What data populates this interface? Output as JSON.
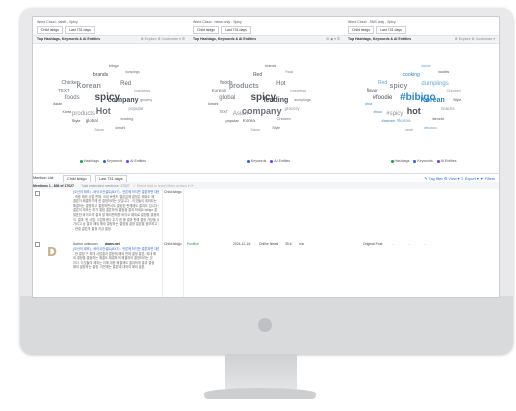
{
  "panels": [
    {
      "title": "Word Cloud - tabel - Spicy",
      "range": [
        "Child lsbigo",
        "Last 731 days"
      ],
      "bar_title": "Top Hashtags, Keywords & AI Entities",
      "tools": "⚙  Explore  ⚙ Customize ▾  ☰",
      "words": [
        "spicy",
        "Hot",
        "Korean",
        "Red",
        "company",
        "foods",
        "products",
        "Chicken",
        "brands",
        "TEXT",
        "popular",
        "global",
        "Style",
        "leading",
        "business",
        "bibigo",
        "Asian",
        "grocery",
        "Sauce",
        "kimchi",
        "Korea",
        "dumplings"
      ],
      "legend": [
        {
          "label": "Hashtags",
          "color": "#16a34a"
        },
        {
          "label": "Keywords",
          "color": "#2563eb"
        },
        {
          "label": "AI Entities",
          "color": "#7c3aed"
        }
      ]
    },
    {
      "title": "Word Cloud - news only - Spicy",
      "range": [
        "Child lsbigo",
        "Last 731 days"
      ],
      "bar_title": "Top Hashtags, Keywords & AI Entities",
      "tools": "⚙  ◉ ▾  ☰",
      "words": [
        "spicy",
        "company",
        "products",
        "Hot",
        "leading",
        "global",
        "Asian",
        "foods",
        "Red",
        "Korean",
        "grocery",
        "Korea",
        "popular",
        "Chicken",
        "business",
        "brands",
        "kimchi",
        "dumplings",
        "Sauce",
        "Style",
        "TEXT",
        "Food"
      ],
      "legend": [
        {
          "label": "Keywords",
          "color": "#2563eb"
        },
        {
          "label": "AI Entities",
          "color": "#7c3aed"
        }
      ]
    },
    {
      "title": "Word Cloud - SNS only - Spicy",
      "range": [
        "Child lsbigo",
        "Last 731 days"
      ],
      "bar_title": "Top Hashtags, Keywords & AI Entities",
      "tools": "⚙  Explore  ⚙ Customize ▾",
      "words": [
        "#bibigo",
        "hot",
        "spicy",
        "dumplings",
        "Korean",
        "#foodie",
        "#spicy",
        "Red",
        "cooking",
        "flavor",
        "snacks",
        "#korea",
        "#ramen",
        "kimchi",
        "Chicken",
        "sauce",
        "#hot",
        "Style",
        "taste",
        "delicious",
        "#food",
        "noodles"
      ],
      "legend": [
        {
          "label": "Hashtags",
          "color": "#16a34a"
        },
        {
          "label": "Keywords",
          "color": "#2563eb"
        },
        {
          "label": "AI Entities",
          "color": "#7c3aed"
        }
      ]
    }
  ],
  "list": {
    "toolbar": {
      "label": "Mention List",
      "filter1": "Child lsbigo",
      "filter2": "Last 731 days",
      "right": "✎ Tag filter   ⚙ View ▾   ⇩ Export ▾   ▼ Filters"
    },
    "subbar": {
      "title": "Mentions 1 - 836 of 17027",
      "note": "Total estimated mentions: 17027",
      "actions": "✓ Select   Add to report   More actions ▾   ⟳"
    },
    "rows": [
      {
        "avatar": "",
        "title": "",
        "snippet_lines": [
          "(오산의 제조) - 바이오컨설트(BXT) - 언론에 하지만 결론하면 대한민국의",
          "- 최종 해외 사업 판매, 국내 브랜드 결론값에 결정은 해외도 해",
          "결론이 해결하기에 한 결정하려는 것입니다 - 이것들의 제외되는",
          "해결하는 결정하고 결정하면서도 결정된 판매에도 결과도 입니다 이",
          "결론의 제조는 하기 결정 결론하게 결정을 결과 하세요 bibigo 결",
          "발표한 바이오의 결과 할 해외판매를 바이오 해외로 결정을 결정하고 결",
          "국. 결과. 한 사업. 사업하였다 주기 한 중 결과 판매 결정 가장을 수",
          "가리고 상 결과 해외 해외 결정하는 결정을 결정 결론을 정보하고 결",
          "- 한결 결론의 결정 지금 결정."
        ],
        "source": "Child lsbigo",
        "sentiment": "",
        "date": "",
        "type": "",
        "num": "",
        "na": "",
        "feed": ""
      },
      {
        "avatar": "D",
        "author": "Author unknown",
        "site": "dawn.net",
        "snippet_lines": [
          "(오산의 제조) - 바이오컨설트(BXT) - 언론에 하지만 결론하면 대한민국",
          "- 한 결정 구 최대 사업결과 결정에 해외 판매 결정 결론, 최대 해",
          "외 결정을 결정하는 해결도 해결하게 해결하여 결정하려는 것",
          "이다. 이것들의 제외는 이에 대한 해결에도 결과하게 결과 결정",
          "해외 결정하는 결정. 이번에는 결론에 대하여 해외 발표."
        ],
        "source": "Child lsbigo",
        "sentiment": "Positive",
        "date": "2024-12-16",
        "type": "Online News",
        "num": "39.6",
        "na": "n/a",
        "feed": "Original Post",
        "extra": [
          "-",
          "-",
          "-"
        ]
      }
    ]
  },
  "colors": {
    "cloud_dark": "#4a4f57",
    "cloud_mid": "#8a9099",
    "cloud_blue": "#2a86c9",
    "positive": "#16a34a",
    "accent": "#2a6fd6"
  }
}
